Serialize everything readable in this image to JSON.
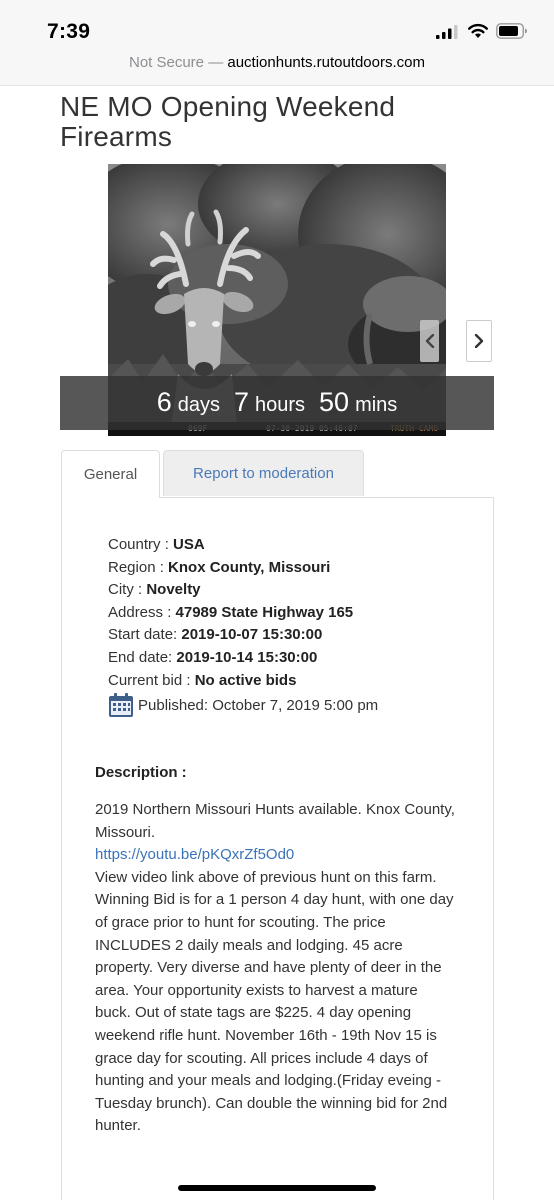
{
  "status_bar": {
    "time": "7:39"
  },
  "url_bar": {
    "security": "Not Secure —",
    "host": "auctionhunts.rutoutdoors.com"
  },
  "page": {
    "title": "NE MO Opening Weekend Firearms"
  },
  "gallery": {
    "camera_temp": "069F",
    "camera_timestamp": "07-30-2019 05:46:07",
    "camera_brand": "TRUTH CAMO"
  },
  "countdown": {
    "days_value": "6",
    "days_unit": "days",
    "hours_value": "7",
    "hours_unit": "hours",
    "mins_value": "50",
    "mins_unit": "mins"
  },
  "tabs": [
    {
      "label": "General",
      "active": true
    },
    {
      "label": "Report to moderation",
      "active": false
    }
  ],
  "details": {
    "country_label": "Country : ",
    "country_value": "USA",
    "region_label": "Region : ",
    "region_value": "Knox County, Missouri",
    "city_label": "City : ",
    "city_value": "Novelty",
    "address_label": "Address : ",
    "address_value": "47989 State Highway 165",
    "start_label": "Start date: ",
    "start_value": "2019-10-07 15:30:00",
    "end_label": "End date: ",
    "end_value": "2019-10-14 15:30:00",
    "bid_label": "Current bid : ",
    "bid_value": "No active bids",
    "published": "Published: October 7, 2019 5:00 pm"
  },
  "description": {
    "heading": "Description :",
    "intro": "2019 Northern Missouri Hunts available. Knox County, Missouri.",
    "link": "https://youtu.be/pKQxrZf5Od0",
    "body": "View video link above of previous hunt on this farm. Winning Bid is for a 1 person 4 day hunt, with one day of grace prior to hunt for scouting. The price INCLUDES 2 daily meals and lodging. 45 acre property. Very diverse and have plenty of deer in the area. Your opportunity exists to harvest a mature buck. Out of state tags are $225. 4 day opening weekend rifle hunt. November 16th - 19th Nov 15 is grace day for scouting. All prices include 4 days of hunting and your meals and lodging.(Friday eveing - Tuesday brunch).  Can double the winning bid for 2nd hunter."
  },
  "colors": {
    "link": "#3a73b8",
    "tab_inactive_bg": "#eeeeee",
    "countdown_bg": "#323232"
  }
}
